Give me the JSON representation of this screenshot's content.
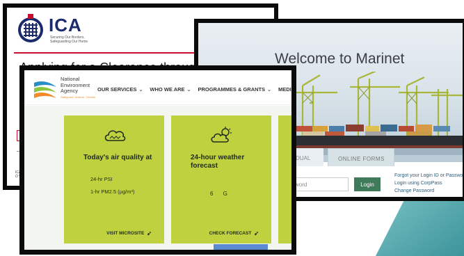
{
  "ica": {
    "brand": "ICA",
    "tagline": "Securing Our Borders, Safeguarding Our Home",
    "page_title": "Applying for a Clearance through CF",
    "footer": "ICA C\nO W"
  },
  "marinet": {
    "heading": "Welcome to Marinet",
    "tabs": [
      "DUAL",
      "ONLINE FORMS"
    ],
    "password_placeholder": "sword",
    "login_label": "Login",
    "links": [
      "Forgot your Login ID or Password?",
      "Login using CorpPass",
      "Change Password"
    ]
  },
  "nea": {
    "org_name": [
      "National",
      "Environment",
      "Agency"
    ],
    "tagline": "Safeguard. Nurture. Cherish",
    "nav": [
      "OUR SERVICES",
      "WHO WE ARE",
      "PROGRAMMES & GRANTS",
      "MEDIA"
    ],
    "cards": {
      "air": {
        "title": "Today's air quality at",
        "line1": "24-hr PSI",
        "line2": "1-hr PM2.5 (µg/m³)",
        "cta": "VISIT MICROSITE"
      },
      "weather": {
        "title": "24-hour weather forecast",
        "glyphs": "6 G",
        "cta": "CHECK FORECAST"
      }
    }
  },
  "colors": {
    "nea_card": "#bfd13e",
    "ica_red": "#c8102e",
    "ica_navy": "#1b2a6b",
    "marinet_green": "#3f7a5a",
    "teal_shape": "#4fa7ad"
  }
}
